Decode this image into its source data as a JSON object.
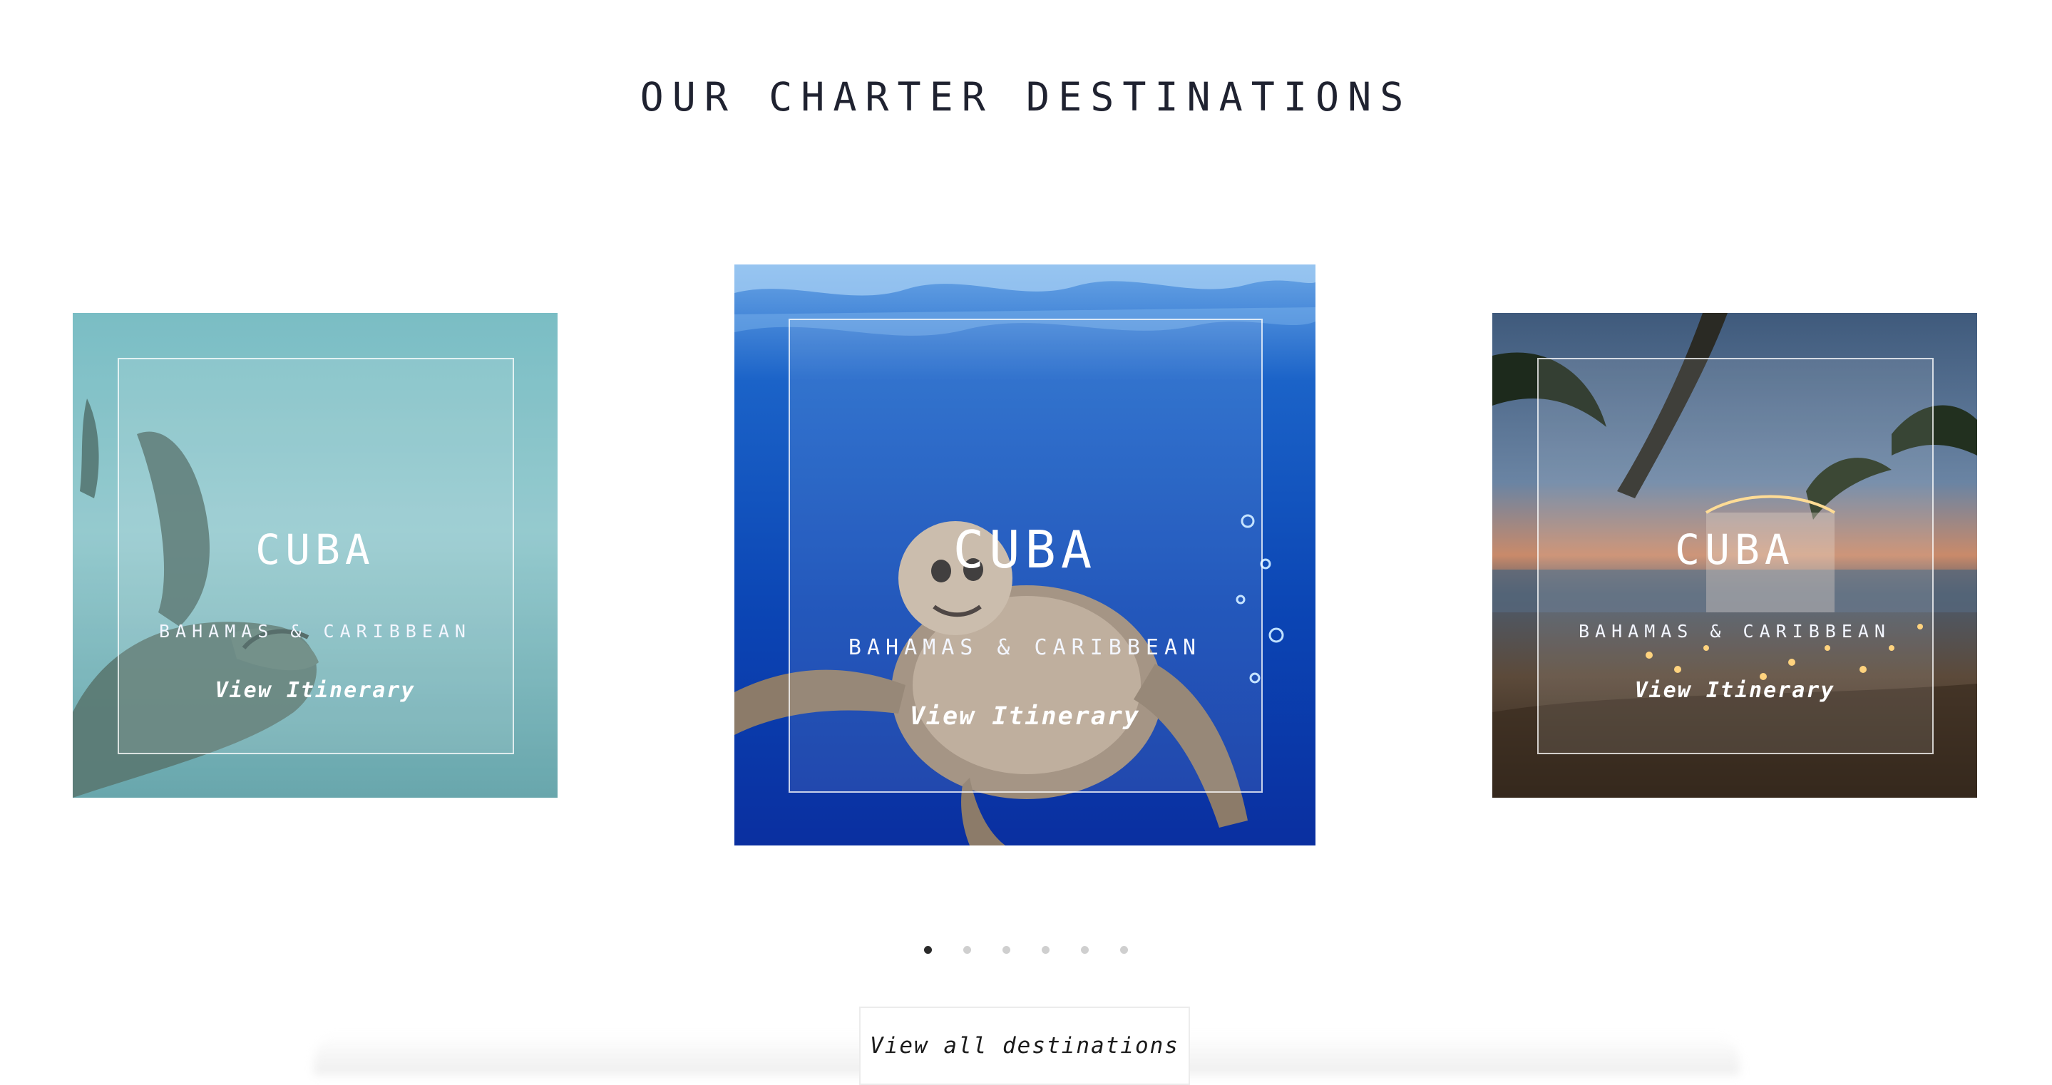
{
  "section": {
    "title": "OUR CHARTER DESTINATIONS"
  },
  "cards": [
    {
      "title": "CUBA",
      "region": "BAHAMAS & CARIBBEAN",
      "link_label": "View Itinerary"
    },
    {
      "title": "CUBA",
      "region": "BAHAMAS & CARIBBEAN",
      "link_label": "View Itinerary"
    },
    {
      "title": "CUBA",
      "region": "BAHAMAS & CARIBBEAN",
      "link_label": "View Itinerary"
    }
  ],
  "carousel": {
    "total": 6,
    "active": 1
  },
  "cta": {
    "label": "View all destinations"
  },
  "colors": {
    "heading": "#1f2230",
    "dot_active": "#2a2a2a",
    "dot_inactive": "#cfcfcf"
  }
}
